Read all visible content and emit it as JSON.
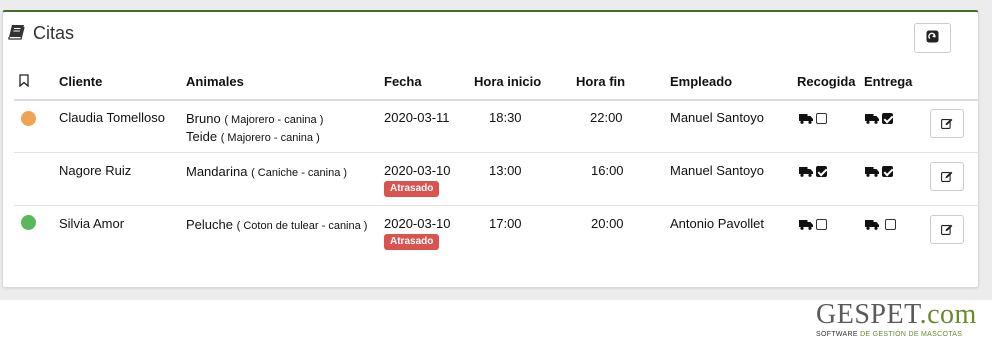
{
  "panel": {
    "title": "Citas",
    "title_icon": "book-icon",
    "refresh_icon": "refresh-icon"
  },
  "columns": {
    "bookmark_icon": "bookmark-icon",
    "cliente": "Cliente",
    "animales": "Animales",
    "fecha": "Fecha",
    "hora_inicio": "Hora inicio",
    "hora_fin": "Hora fin",
    "empleado": "Empleado",
    "recogida": "Recogida",
    "entrega": "Entrega"
  },
  "rows": [
    {
      "status_color": "#f0a350",
      "cliente": "Claudia Tomelloso",
      "animals": [
        {
          "name": "Bruno",
          "detail": "( Majorero - canina )"
        },
        {
          "name": "Teide",
          "detail": "( Majorero - canina )"
        }
      ],
      "fecha": "2020-03-11",
      "badge": "",
      "hora_inicio": "18:30",
      "hora_fin": "22:00",
      "empleado": "Manuel Santoyo",
      "recogida_checked": false,
      "entrega_checked": true
    },
    {
      "status_color": "",
      "cliente": "Nagore Ruiz",
      "animals": [
        {
          "name": "Mandarina",
          "detail": "( Caniche - canina )"
        }
      ],
      "fecha": "2020-03-10",
      "badge": "Atrasado",
      "hora_inicio": "13:00",
      "hora_fin": "16:00",
      "empleado": "Manuel Santoyo",
      "recogida_checked": true,
      "entrega_checked": true
    },
    {
      "status_color": "#5cb85c",
      "cliente": "Silvia Amor",
      "animals": [
        {
          "name": "Peluche",
          "detail": "( Coton de tulear - canina )"
        }
      ],
      "fecha": "2020-03-10",
      "badge": "Atrasado",
      "hora_inicio": "17:00",
      "hora_fin": "20:00",
      "empleado": "Antonio Pavollet",
      "recogida_checked": false,
      "entrega_checked": false
    }
  ],
  "icons": {
    "truck": "truck-icon",
    "edit": "edit-icon"
  },
  "logo": {
    "brand_a": "GESPET",
    "brand_b": ".com",
    "tag_a": "SOFTWARE ",
    "tag_b": "DE GESTIÓN DE MASCOTAS"
  },
  "colors": {
    "accent": "#4a6a2a",
    "badge": "#d9534f"
  }
}
